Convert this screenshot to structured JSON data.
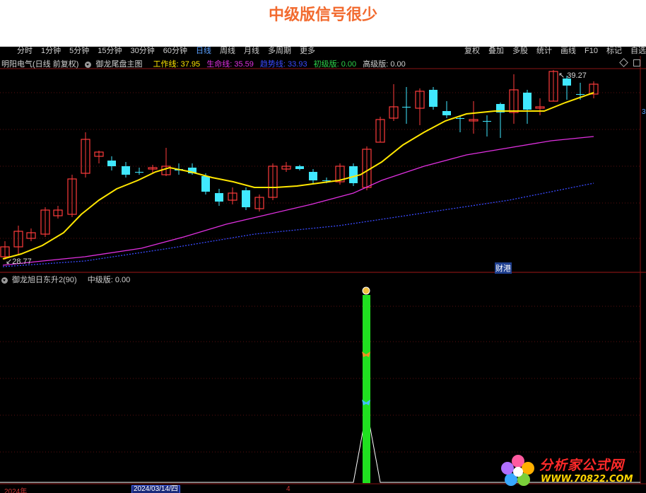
{
  "headline": "中级版信号很少",
  "toolbar": {
    "left_items": [
      "分时",
      "1分钟",
      "5分钟",
      "15分钟",
      "30分钟",
      "60分钟",
      "日线",
      "周线",
      "月线",
      "多周期",
      "更多"
    ],
    "active_item": "日线",
    "right_items": [
      "复权",
      "叠加",
      "多股",
      "统计",
      "画线",
      "F10",
      "标记",
      "自选"
    ]
  },
  "main_panel": {
    "stock": "明阳电气(日线 前复权)",
    "indicator": "御龙尾盘主图",
    "work_line": "工作线: 37.95",
    "life_line": "生命线: 35.59",
    "trend_line": "趋势线: 33.93",
    "primary": "初级版: 0.00",
    "advanced": "高级版: 0.00",
    "high_label": "39.27",
    "low_label": "28.77",
    "caigang": "财港",
    "colors": {
      "work": "#ffe600",
      "life": "#e030e0",
      "trend": "#3a4aff",
      "primary": "#2dd24a",
      "label": "#d8d8d8"
    }
  },
  "sub_panel": {
    "indicator": "御龙旭日东升2(90)",
    "value": "中级版: 0.00"
  },
  "axis": {
    "year": "2024年",
    "date": "2024/03/14/四",
    "tick": "4"
  },
  "right_marker": "3",
  "watermark": {
    "title": "分析家公式网",
    "url": "WWW.70822.COM"
  }
}
